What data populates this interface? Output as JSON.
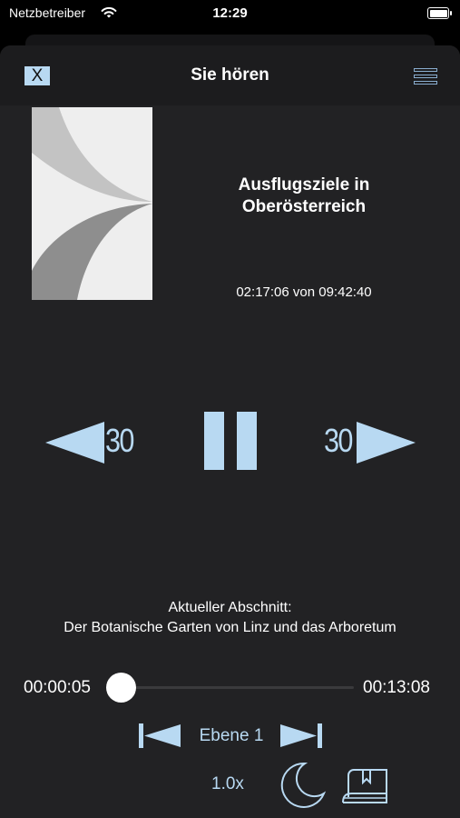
{
  "status_bar": {
    "carrier": "Netzbetreiber",
    "time": "12:29",
    "wifi_icon": "wifi-icon",
    "battery_icon": "battery-icon"
  },
  "header": {
    "close_label": "X",
    "title": "Sie hören",
    "menu_icon": "hamburger-menu-icon"
  },
  "book": {
    "title_line1": "Ausflugsziele in",
    "title_line2": "Oberösterreich",
    "time_progress": "02:17:06 von 09:42:40"
  },
  "controls": {
    "rewind_seconds": "30",
    "forward_seconds": "30",
    "play_state_icon": "pause-icon"
  },
  "section": {
    "label": "Aktueller Abschnitt:",
    "title": "Der Botanische Garten von Linz und das Arboretum"
  },
  "progress": {
    "position": "00:00:05",
    "duration": "00:13:08",
    "fraction": 0.006
  },
  "navigation": {
    "level_label": "Ebene 1"
  },
  "footer": {
    "speed": "1.0x",
    "sleep_icon": "moon-icon",
    "bookmark_icon": "bookmark-icon"
  },
  "colors": {
    "accent": "#b8d9f2",
    "background": "#222224",
    "header_background": "#1c1c1e"
  }
}
